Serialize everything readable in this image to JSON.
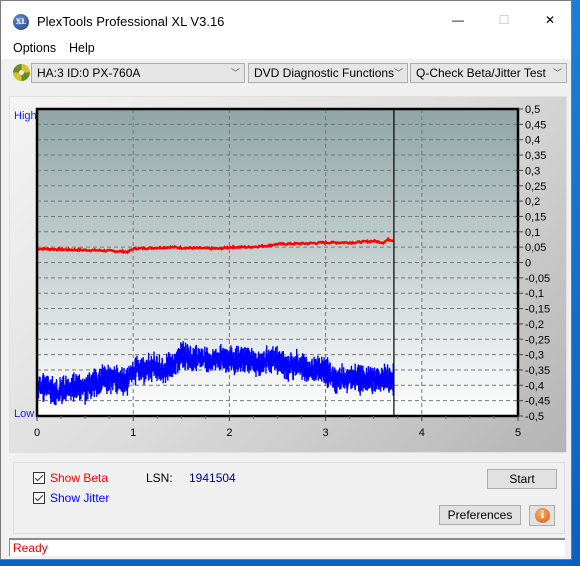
{
  "window": {
    "title": "PlexTools Professional XL V3.16",
    "app_icon": "XL",
    "controls": {
      "minimize": "—",
      "maximize": "☐",
      "close": "✕"
    }
  },
  "menu": {
    "items": [
      "Options",
      "Help"
    ]
  },
  "toolbar": {
    "drive_icon": "disc-icon",
    "drive": "HA:3 ID:0  PX-760A",
    "function": "DVD Diagnostic Functions",
    "test": "Q-Check Beta/Jitter Test",
    "chevron": "﹀"
  },
  "chart": {
    "high_label": "High",
    "low_label": "Low"
  },
  "chart_data": {
    "type": "line",
    "title": "",
    "xlabel": "",
    "ylabel": "",
    "xlim": [
      0,
      5
    ],
    "ylim": [
      -0.5,
      0.5
    ],
    "x_ticks": [
      "0",
      "1",
      "2",
      "3",
      "4",
      "5"
    ],
    "y_ticks_right": [
      "0,5",
      "0,45",
      "0,4",
      "0,35",
      "0,3",
      "0,25",
      "0,2",
      "0,15",
      "0,1",
      "0,05",
      "0",
      "-0,05",
      "-0,1",
      "-0,15",
      "-0,2",
      "-0,25",
      "-0,3",
      "-0,35",
      "-0,4",
      "-0,45",
      "-0,5"
    ],
    "grid": true,
    "cursor_x": 3.71,
    "series": [
      {
        "name": "Beta",
        "color": "#ff0000",
        "x": [
          0,
          0.3,
          0.6,
          0.95,
          1.0,
          1.4,
          1.5,
          1.9,
          2.0,
          2.2,
          2.4,
          2.5,
          2.8,
          3.0,
          3.3,
          3.5,
          3.6,
          3.65,
          3.71
        ],
        "y": [
          0.045,
          0.042,
          0.04,
          0.035,
          0.045,
          0.05,
          0.048,
          0.045,
          0.05,
          0.05,
          0.055,
          0.06,
          0.062,
          0.065,
          0.065,
          0.07,
          0.065,
          0.075,
          0.072
        ]
      },
      {
        "name": "Jitter",
        "color": "#0000ff",
        "x": [
          0,
          0.1,
          0.2,
          0.3,
          0.4,
          0.5,
          0.6,
          0.7,
          0.8,
          0.9,
          0.95,
          1.0,
          1.1,
          1.2,
          1.3,
          1.4,
          1.5,
          1.6,
          1.7,
          1.8,
          1.9,
          2.0,
          2.1,
          2.2,
          2.3,
          2.4,
          2.5,
          2.6,
          2.7,
          2.8,
          2.9,
          3.0,
          3.1,
          3.2,
          3.3,
          3.4,
          3.5,
          3.6,
          3.71
        ],
        "y": [
          -0.41,
          -0.4,
          -0.43,
          -0.41,
          -0.4,
          -0.41,
          -0.39,
          -0.38,
          -0.38,
          -0.39,
          -0.38,
          -0.35,
          -0.35,
          -0.34,
          -0.35,
          -0.34,
          -0.3,
          -0.31,
          -0.31,
          -0.32,
          -0.31,
          -0.32,
          -0.32,
          -0.32,
          -0.33,
          -0.32,
          -0.32,
          -0.34,
          -0.33,
          -0.35,
          -0.35,
          -0.35,
          -0.38,
          -0.38,
          -0.38,
          -0.38,
          -0.38,
          -0.38,
          -0.38
        ]
      }
    ]
  },
  "controls": {
    "show_beta": {
      "label": "Show Beta",
      "checked": true,
      "color": "#ff0000"
    },
    "show_jitter": {
      "label": "Show Jitter",
      "checked": true,
      "color": "#0000ff"
    },
    "lsn_label": "LSN:",
    "lsn_value": "1941504",
    "start": "Start",
    "preferences": "Preferences",
    "info_icon": "i"
  },
  "status": {
    "text": "Ready"
  }
}
